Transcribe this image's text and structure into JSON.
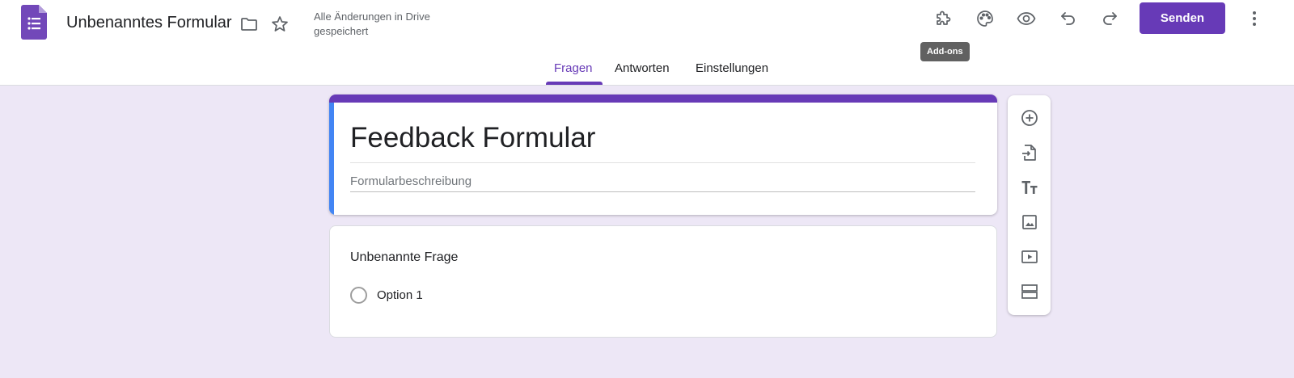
{
  "header": {
    "doc_title": "Unbenanntes Formular",
    "save_status": "Alle Änderungen in Drive gespeichert",
    "send_label": "Senden",
    "tooltip": "Add-ons",
    "icons": [
      "forms-logo-icon",
      "folder-icon",
      "star-icon",
      "puzzle-icon",
      "palette-icon",
      "eye-icon",
      "undo-icon",
      "redo-icon",
      "more-vert-icon"
    ]
  },
  "tabs": [
    {
      "label": "Fragen",
      "active": true
    },
    {
      "label": "Antworten",
      "active": false
    },
    {
      "label": "Einstellungen",
      "active": false
    }
  ],
  "form": {
    "title": "Feedback Formular",
    "description_placeholder": "Formularbeschreibung"
  },
  "question": {
    "title": "Unbenannte Frage",
    "options": [
      "Option 1"
    ]
  },
  "toolbar": {
    "icons": [
      "add-circle-icon",
      "import-icon",
      "text-format-icon",
      "image-icon",
      "video-icon",
      "section-icon"
    ]
  },
  "colors": {
    "accent": "#673ab7",
    "background": "#ede7f6",
    "left_accent": "#4285f4"
  }
}
